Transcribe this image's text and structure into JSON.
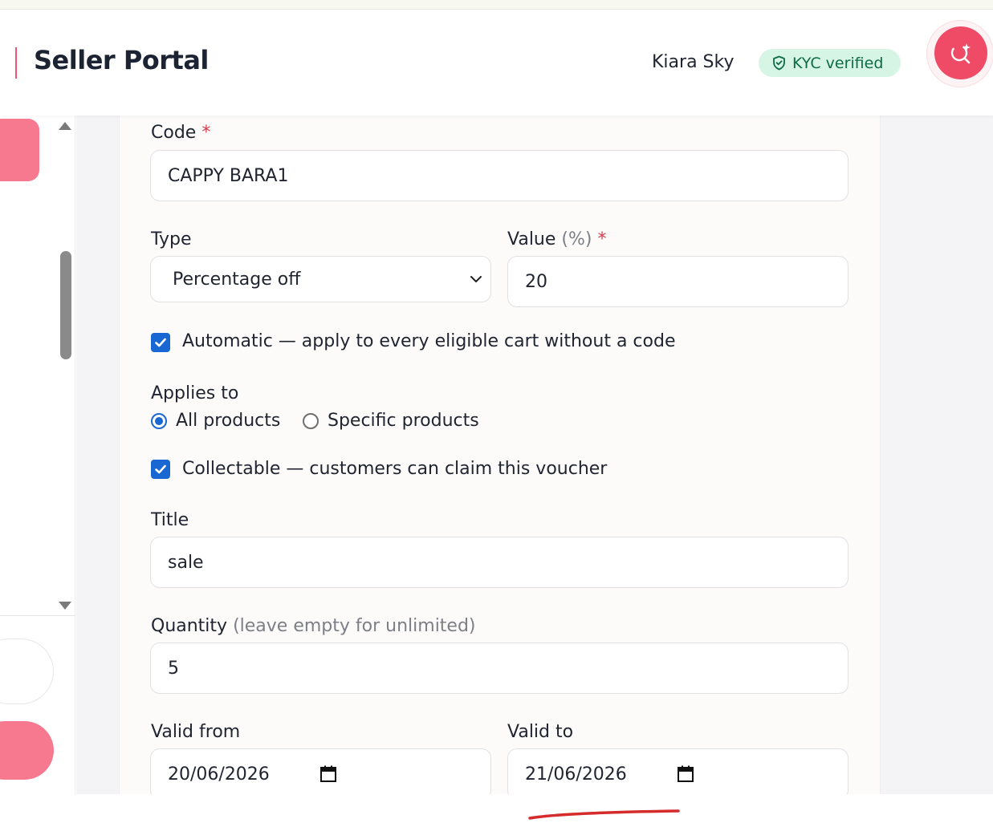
{
  "header": {
    "title": "Seller Portal",
    "user_name": "Kiara Sky",
    "kyc_label": "KYC verified"
  },
  "colors": {
    "brand_accent": "#ef4b66",
    "kyc_bg": "#d6f5e4",
    "kyc_text": "#0f6b45",
    "checkbox_blue": "#1967d2",
    "required_star": "#d83a4e"
  },
  "form": {
    "code": {
      "label": "Code",
      "required_mark": "*",
      "value": "CAPPY BARA1"
    },
    "type": {
      "label": "Type",
      "selected": "Percentage off"
    },
    "value": {
      "label": "Value",
      "hint": "(%)",
      "required_mark": "*",
      "value": "20"
    },
    "automatic": {
      "checked": true,
      "label": "Automatic — apply to every eligible cart without a code"
    },
    "applies_to": {
      "label": "Applies to",
      "options": [
        {
          "label": "All products",
          "selected": true
        },
        {
          "label": "Specific products",
          "selected": false
        }
      ]
    },
    "collectable": {
      "checked": true,
      "label": "Collectable — customers can claim this voucher"
    },
    "title": {
      "label": "Title",
      "value": "sale"
    },
    "quantity": {
      "label": "Quantity",
      "hint": "(leave empty for unlimited)",
      "value": "5"
    },
    "valid_from": {
      "label": "Valid from",
      "value": "20/06/2026"
    },
    "valid_to": {
      "label": "Valid to",
      "value": "21/06/2026"
    }
  },
  "icons": {
    "kyc": "shield-check-icon",
    "action": "search-sparkle-icon",
    "select": "chevron-down-icon",
    "date": "calendar-icon"
  }
}
